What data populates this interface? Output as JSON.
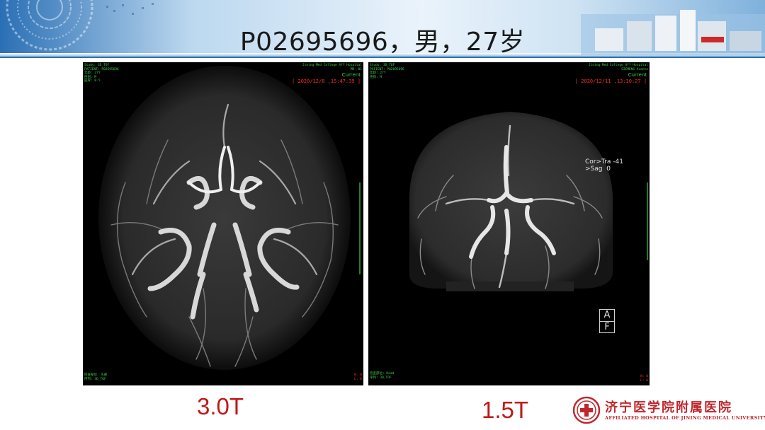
{
  "slide": {
    "title": "P02695696，男，27岁"
  },
  "left_scan": {
    "date": "[ 2020/12/8 ,15:47:39 ]",
    "status": "Current",
    "field_label": "3.0T",
    "top_left_lines": "Study: 3D_TOF\nPATIENT: P02695696\n年龄: 27Y\n性别: M\n层厚: 0.5",
    "top_right_lines": "Jining Med College Aff Hospital\nMR  01",
    "bottom_left_lines": "检查部位: 头部\n序列: 3D_TOF",
    "bottom_right_lines": "W: 0\nL: 0"
  },
  "right_scan": {
    "date": "[ 2020/12/11 ,13:10:27 ]",
    "status": "Current",
    "field_label": "1.5T",
    "top_left_lines": "Study: 3D_TOF\nPATIENT: P02695696\n年龄: 27Y\n性别: M",
    "top_right_lines": "Jining Med College Aff Hospital\nSIEMENS Avanto",
    "orientation": "Cor>Tra -41\n>Sag  0",
    "orientation_box": [
      "A",
      "F"
    ],
    "bottom_left_lines": "检查部位: Head\n序列: 3D_TOF",
    "bottom_right_lines": "W: 0\nL: 0"
  },
  "logo": {
    "name": "济宁医学院附属医院",
    "english": "AFFILIATED HOSPITAL OF JINING MEDICAL UNIVERSITY"
  }
}
